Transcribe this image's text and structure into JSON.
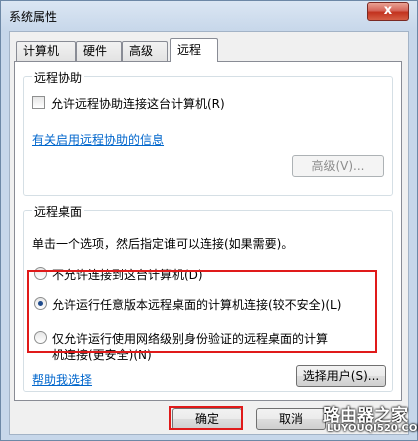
{
  "window": {
    "title": "系统属性",
    "close_glyph": "x"
  },
  "tabs": [
    "计算机名",
    "硬件",
    "高级",
    "远程"
  ],
  "remote_assistance": {
    "group_title": "远程协助",
    "allow_label": "允许远程协助连接这台计算机(R)",
    "allow_checked": false,
    "info_link": "有关启用远程协助的信息",
    "advanced_button": "高级(V)..."
  },
  "remote_desktop": {
    "group_title": "远程桌面",
    "instruction": "单击一个选项，然后指定谁可以连接(如果需要)。",
    "options": [
      "不允许连接到这台计算机(D)",
      "允许运行任意版本远程桌面的计算机连接(较不安全)(L)",
      "仅允许运行使用网络级别身份验证的远程桌面的计算机连接(更安全)(N)"
    ],
    "option3_line1": "仅允许运行使用网络级别身份验证的远程桌面的计算",
    "option3_line2": "机连接(更安全)(N)",
    "selected_index": 1,
    "help_link": "帮助我选择",
    "select_users_button": "选择用户(S)..."
  },
  "footer": {
    "ok_button": "确定",
    "cancel_button": "取消"
  },
  "watermark": {
    "line1": "路由器之家",
    "line2": "LUYOUQI520.COM"
  },
  "colors": {
    "highlight": "#e01a1a",
    "link": "#0066cc"
  }
}
